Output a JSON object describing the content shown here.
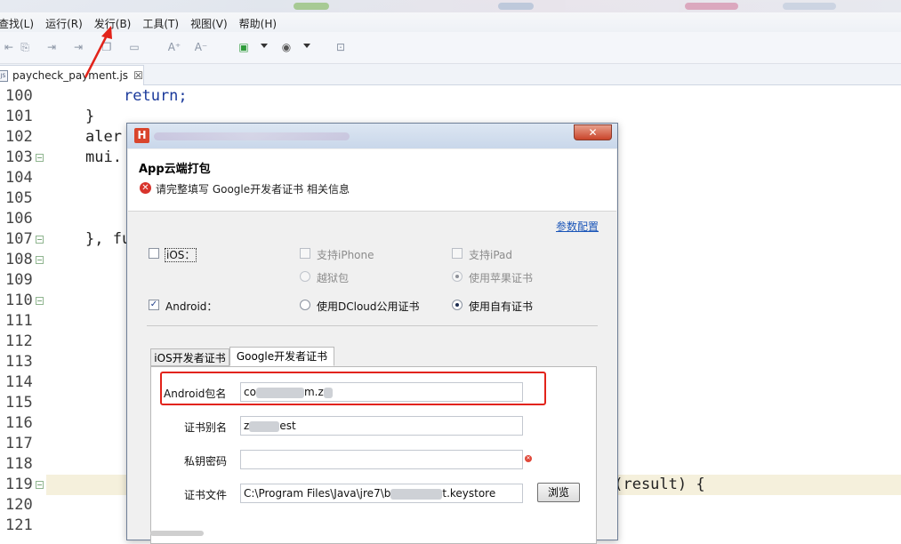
{
  "menubar": {
    "items": [
      "查找(L)",
      "运行(R)",
      "发行(B)",
      "工具(T)",
      "视图(V)",
      "帮助(H)"
    ]
  },
  "editor": {
    "tab_name": "paycheck_payment.js",
    "tab_close": "☒",
    "line_numbers": [
      "100",
      "101",
      "102",
      "103",
      "104",
      "105",
      "106",
      "107",
      "108",
      "109",
      "110",
      "111",
      "112",
      "113",
      "114",
      "115",
      "116",
      "117",
      "118",
      "119",
      "120",
      "121"
    ],
    "code": {
      "l100": "return;",
      "l101": "}",
      "l102a": "aler",
      "l103a": "mui.",
      "l107a": "}, fu",
      "l119": "n(result) {"
    }
  },
  "dialog": {
    "title_icon": "H",
    "close_label": "✕",
    "heading": "App云端打包",
    "error_message": "请完整填写 Google开发者证书 相关信息",
    "link_config": "参数配置",
    "ios_label": "iOS：",
    "android_label": "Android：",
    "ios_options": {
      "support_iphone": "支持iPhone",
      "support_ipad": "支持iPad",
      "jailbreak": "越狱包",
      "apple_cert": "使用苹果证书"
    },
    "android_options": {
      "dcloud_cert": "使用DCloud公用证书",
      "own_cert": "使用自有证书"
    },
    "tabs": [
      "iOS开发者证书",
      "Google开发者证书"
    ],
    "fields": {
      "package_label": "Android包名",
      "package_value_start": "co",
      "package_value_end": "m.z",
      "alias_label": "证书别名",
      "alias_value_start": "z",
      "alias_value_end": "est",
      "password_label": "私钥密码",
      "password_value": "",
      "file_label": "证书文件",
      "file_value_start": "C:\\Program Files\\Java\\jre7\\b",
      "file_value_end": "t.keystore",
      "browse_label": "浏览"
    },
    "state": {
      "ios_checked": false,
      "android_checked": true,
      "selected_android_option": "使用自有证书",
      "active_tab": "Google开发者证书"
    }
  },
  "colors": {
    "annotation_red": "#e2231a",
    "link_blue": "#1a55b8",
    "keyword_blue": "#1b3a9b"
  }
}
